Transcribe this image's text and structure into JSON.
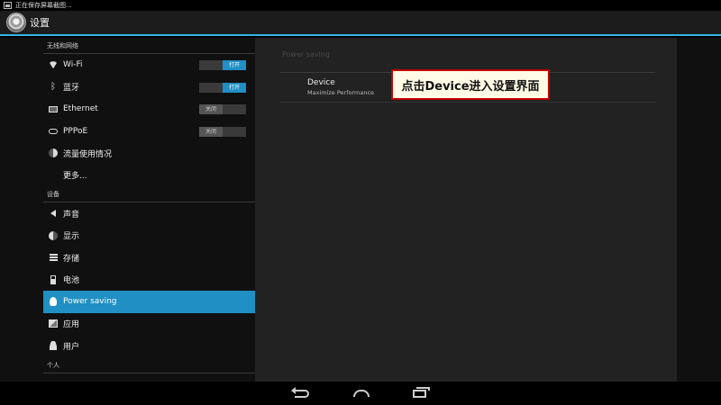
{
  "status_bar": {
    "text": "正在保存屏幕截图..."
  },
  "action_bar": {
    "title": "设置"
  },
  "sidebar": {
    "sections": [
      {
        "header": "无线和网络",
        "items": [
          {
            "icon": "wifi-icon",
            "label": "Wi-Fi",
            "toggle": "打开"
          },
          {
            "icon": "bluetooth-icon",
            "label": "蓝牙",
            "toggle": "打开"
          },
          {
            "icon": "ethernet-icon",
            "label": "Ethernet",
            "toggle": "关闭"
          },
          {
            "icon": "pppoe-icon",
            "label": "PPPoE",
            "toggle": "关闭"
          },
          {
            "icon": "data-usage-icon",
            "label": "流量使用情况"
          },
          {
            "label": "更多..."
          }
        ]
      },
      {
        "header": "设备",
        "items": [
          {
            "icon": "sound-icon",
            "label": "声音"
          },
          {
            "icon": "display-icon",
            "label": "显示"
          },
          {
            "icon": "storage-icon",
            "label": "存储"
          },
          {
            "icon": "battery-icon",
            "label": "电池"
          },
          {
            "icon": "power-saving-icon",
            "label": "Power saving",
            "selected": true
          },
          {
            "icon": "apps-icon",
            "label": "应用"
          },
          {
            "icon": "user-icon",
            "label": "用户"
          }
        ]
      },
      {
        "header": "个人"
      }
    ]
  },
  "panel": {
    "header": "Power saving",
    "item_title": "Device",
    "item_subtitle": "Maximize Performance"
  },
  "callout": {
    "text": "点击Device进入设置界面"
  },
  "colors": {
    "accent": "#1f8fc4",
    "callout_border": "#c40000",
    "callout_bg": "#fffbe6"
  }
}
